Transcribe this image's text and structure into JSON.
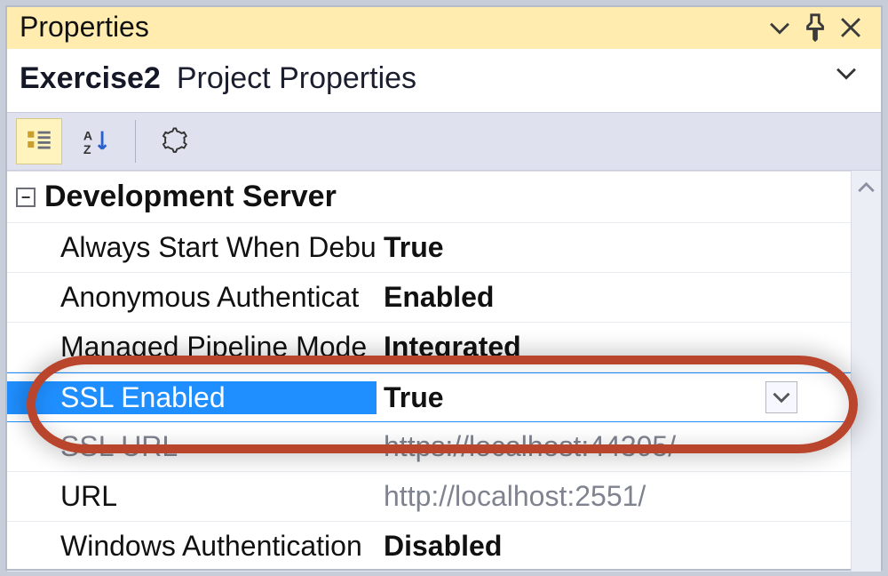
{
  "panel": {
    "title": "Properties"
  },
  "subtitle": {
    "project": "Exercise2",
    "label": "Project Properties"
  },
  "category": {
    "label": "Development Server"
  },
  "rows": [
    {
      "key": "Always Start When Debu",
      "value": "True",
      "dim": false,
      "readonly": false
    },
    {
      "key": "Anonymous Authenticat",
      "value": "Enabled",
      "dim": false,
      "readonly": false
    },
    {
      "key": "Managed Pipeline Mode",
      "value": "Integrated",
      "dim": false,
      "readonly": false
    },
    {
      "key": "SSL Enabled",
      "value": "True",
      "dim": false,
      "readonly": false
    },
    {
      "key": "SSL URL",
      "value": "https://localhost:44305/",
      "dim": true,
      "readonly": true
    },
    {
      "key": "URL",
      "value": "http://localhost:2551/",
      "dim": true,
      "readonly": false
    },
    {
      "key": "Windows Authentication",
      "value": "Disabled",
      "dim": false,
      "readonly": false
    }
  ],
  "selected_index": 3
}
